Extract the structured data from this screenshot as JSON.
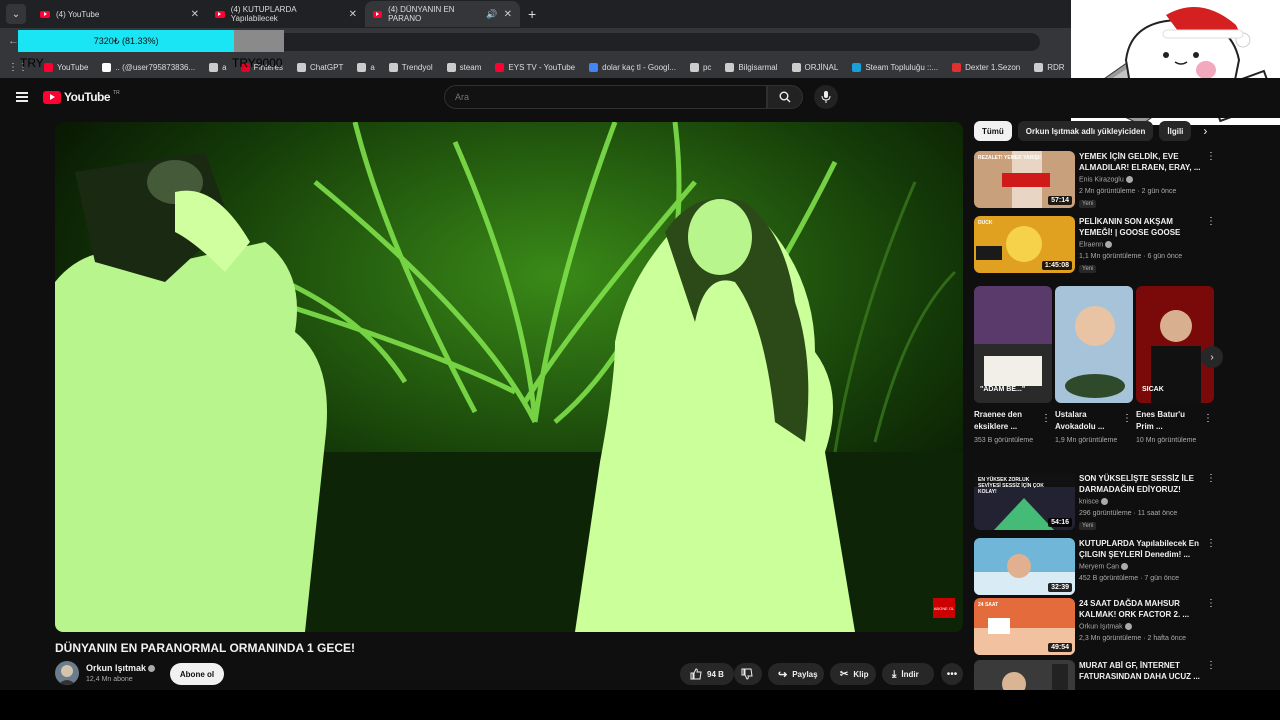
{
  "browser": {
    "tabs": [
      {
        "label": "(4) YouTube",
        "active": false
      },
      {
        "label": "(4) KUTUPLARDA Yapılabilecek",
        "active": false
      },
      {
        "label": "(4) DÜNYANIN EN PARANO",
        "active": true
      }
    ],
    "new_tab": "+",
    "bookmarks": [
      {
        "label": "YouTube",
        "color": "#ff0033"
      },
      {
        "label": ".. (@user795873836...",
        "color": "#ffffff"
      },
      {
        "label": "a",
        "color": "#cccccc"
      },
      {
        "label": "Pinteres",
        "color": "#e60023"
      },
      {
        "label": "ChatGPT",
        "color": "#cccccc"
      },
      {
        "label": "a",
        "color": "#cccccc"
      },
      {
        "label": "Trendyol",
        "color": "#cccccc"
      },
      {
        "label": "steam",
        "color": "#cccccc"
      },
      {
        "label": "EYS TV - YouTube",
        "color": "#ff0033"
      },
      {
        "label": "dolar kaç tl - Googl...",
        "color": "#4285f4"
      },
      {
        "label": "pc",
        "color": "#cccccc"
      },
      {
        "label": "Bilgisarmal",
        "color": "#cccccc"
      },
      {
        "label": "ORJİNAL",
        "color": "#cccccc"
      },
      {
        "label": "Steam Topluluğu ::...",
        "color": "#1b9fd8"
      },
      {
        "label": "Dexter 1.Sezon",
        "color": "#e03030"
      },
      {
        "label": "RDR",
        "color": "#cccccc"
      }
    ]
  },
  "overlay": {
    "progress_text": "7320₺ (81.33%)",
    "progress_fraction": 0.8133,
    "try_left": "TRY",
    "try_right": "TRY9000"
  },
  "youtube": {
    "logo_text": "YouTube",
    "logo_region": "TR",
    "search_placeholder": "Ara",
    "video_title": "DÜNYANIN EN PARANORMAL ORMANINDA 1 GECE!",
    "subscribe_badge": "ABONE OL",
    "channel": {
      "name": "Orkun Işıtmak",
      "subs": "12,4 Mn abone"
    },
    "subscribe_label": "Abone ol",
    "actions": {
      "likes": "94 B",
      "share": "Paylaş",
      "clip": "Klip",
      "download": "İndir"
    },
    "chips": [
      "Tümü",
      "Orkun Işıtmak adlı yükleyiciden",
      "İlgili"
    ],
    "recs_top": [
      {
        "title": "YEMEK İÇİN GELDİK, EVE ALMADILAR! ELRAEN, ERAY, ...",
        "channel": "Enis Kirazoglu",
        "meta": "2 Mn görüntüleme · 2 gün önce",
        "badge": "Yeni",
        "duration": "57:14",
        "thumb_text": "REZALET! YEMEK YARIŞI!"
      },
      {
        "title": "PELİKANIN SON AKŞAM YEMEĞİ! | GOOSE GOOSE DUC...",
        "channel": "Elraenn",
        "meta": "1,1 Mn görüntüleme · 6 gün önce",
        "badge": "Yeni",
        "duration": "1:45:08",
        "thumb_text": "DUCK"
      }
    ],
    "shorts": [
      {
        "title": "Rraenee den eksiklere ...",
        "views": "353 B görüntüleme",
        "thumb_text": "\"ADAM BE...\""
      },
      {
        "title": "Ustalara Avokadolu ...",
        "views": "1,9 Mn görüntüleme",
        "thumb_text": ""
      },
      {
        "title": "Enes Batur'u Prim ...",
        "views": "10 Mn görüntüleme",
        "thumb_text": "SICAK"
      }
    ],
    "recs_bottom": [
      {
        "title": "SON YÜKSELİŞTE SESSİZ İLE DARMADAĞIN EDİYORUZ! (Sla...",
        "channel": "knisce",
        "meta": "296 görüntüleme · 11 saat önce",
        "badge": "Yeni",
        "duration": "54:16",
        "thumb_text": "EN YÜKSEK ZORLUK SEVİYESİ SESSİZ İÇİN ÇOK KOLAY!"
      },
      {
        "title": "KUTUPLARDA Yapılabilecek En ÇILGIN ŞEYLERİ Denedim! ...",
        "channel": "Meryem Can",
        "meta": "452 B görüntüleme · 7 gün önce",
        "badge": "",
        "duration": "32:39",
        "thumb_text": ""
      },
      {
        "title": "24 SAAT DAĞDA MAHSUR KALMAK! ORK FACTOR 2. ...",
        "channel": "Orkun Işıtmak",
        "meta": "2,3 Mn görüntüleme · 2 hafta önce",
        "badge": "",
        "duration": "49:54",
        "thumb_text": "24 SAAT"
      },
      {
        "title": "MURAT ABİ GF, İNTERNET FATURASINDAN DAHA UCUZ ...",
        "channel": "",
        "meta": "",
        "badge": "",
        "duration": "",
        "thumb_text": ""
      }
    ]
  }
}
